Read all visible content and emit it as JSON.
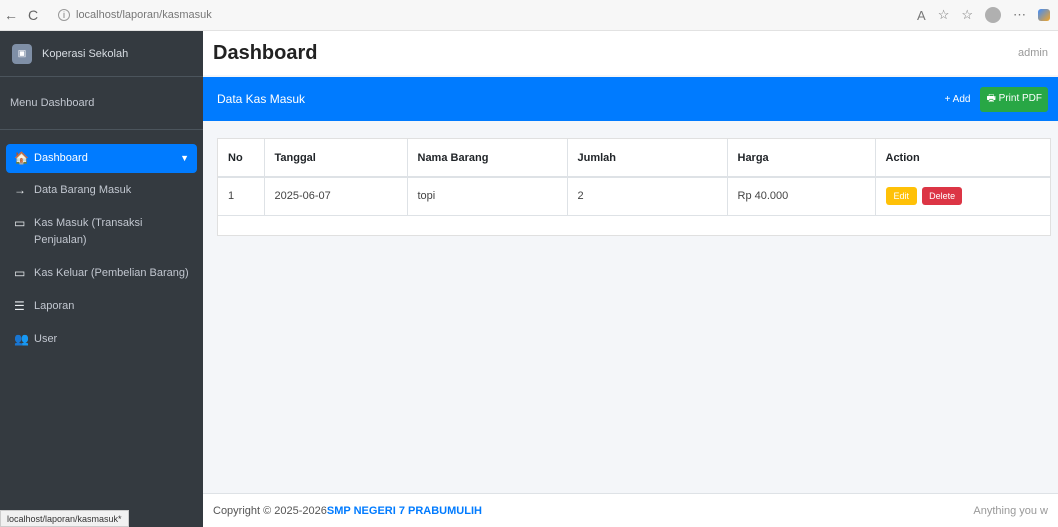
{
  "browser": {
    "back_icon": "←",
    "reload_icon": "C",
    "url": "localhost/laporan/kasmasuk",
    "status_url": "localhost/laporan/kasmasuk*"
  },
  "sidebar": {
    "brand": "Koperasi Sekolah",
    "menu_header": "Menu Dashboard",
    "items": [
      {
        "label": "Dashboard",
        "icon": "home-icon",
        "glyph": "🏠",
        "active": true
      },
      {
        "label": "Data Barang Masuk",
        "icon": "arrow-right-icon",
        "glyph": "→"
      },
      {
        "label": "Kas Masuk (Transaksi Penjualan)",
        "icon": "money-icon",
        "glyph": "▭"
      },
      {
        "label": "Kas Keluar (Pembelian Barang)",
        "icon": "money-icon",
        "glyph": "▭"
      },
      {
        "label": "Laporan",
        "icon": "list-icon",
        "glyph": "☰"
      },
      {
        "label": "User",
        "icon": "users-icon",
        "glyph": "👥"
      }
    ]
  },
  "header": {
    "title": "Dashboard",
    "user": "admin"
  },
  "card": {
    "title": "Data Kas Masuk",
    "add_label": "+ Add",
    "pdf_label": "🖶 Print PDF",
    "columns": [
      "No",
      "Tanggal",
      "Nama Barang",
      "Jumlah",
      "Harga",
      "Action"
    ],
    "rows": [
      {
        "no": "1",
        "tanggal": "2025-06-07",
        "nama": "topi",
        "jumlah": "2",
        "harga": "Rp 40.000",
        "edit": "Edit",
        "delete": "Delete"
      }
    ]
  },
  "footer": {
    "copyright": "Copyright © 2025-2026 ",
    "school": "SMP NEGERI 7 PRABUMULIH",
    "right": "Anything you w"
  },
  "colors": {
    "primary": "#007bff",
    "sidebar": "#343a40",
    "success": "#28a745",
    "warning": "#ffc107",
    "danger": "#dc3545"
  }
}
